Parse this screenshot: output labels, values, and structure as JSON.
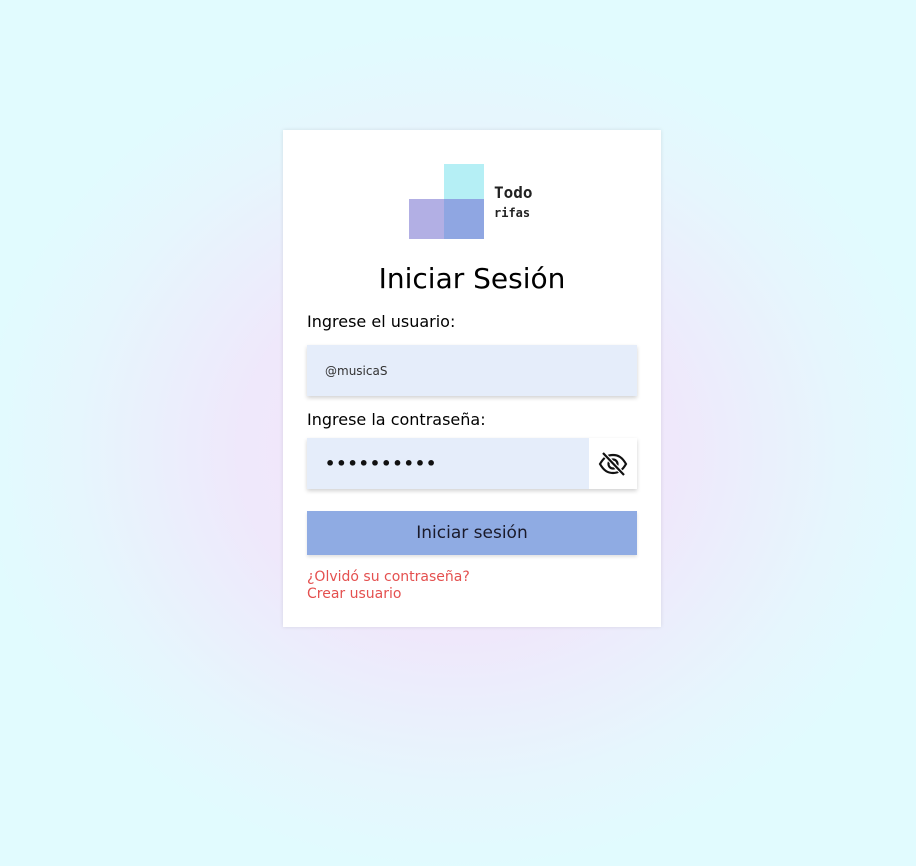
{
  "logo": {
    "brand_top": "Todo",
    "brand_bottom": "rifas",
    "colors": {
      "cyan": "#b5eff5",
      "purple": "#b2afe4",
      "blue": "#8fa6e2"
    }
  },
  "login": {
    "title": "Iniciar Sesión",
    "username_label": "Ingrese el usuario:",
    "username_value": "@musicaS",
    "password_label": "Ingrese la contraseña:",
    "password_value": "••••••••••",
    "toggle_icon": "eye-off-icon",
    "submit_label": "Iniciar sesión",
    "forgot_link": "¿Olvidó su contraseña?",
    "create_link": "Crear usuario"
  },
  "colors": {
    "button": "#8fabe3",
    "input_bg": "#e5edfa",
    "link": "#e4504f"
  }
}
